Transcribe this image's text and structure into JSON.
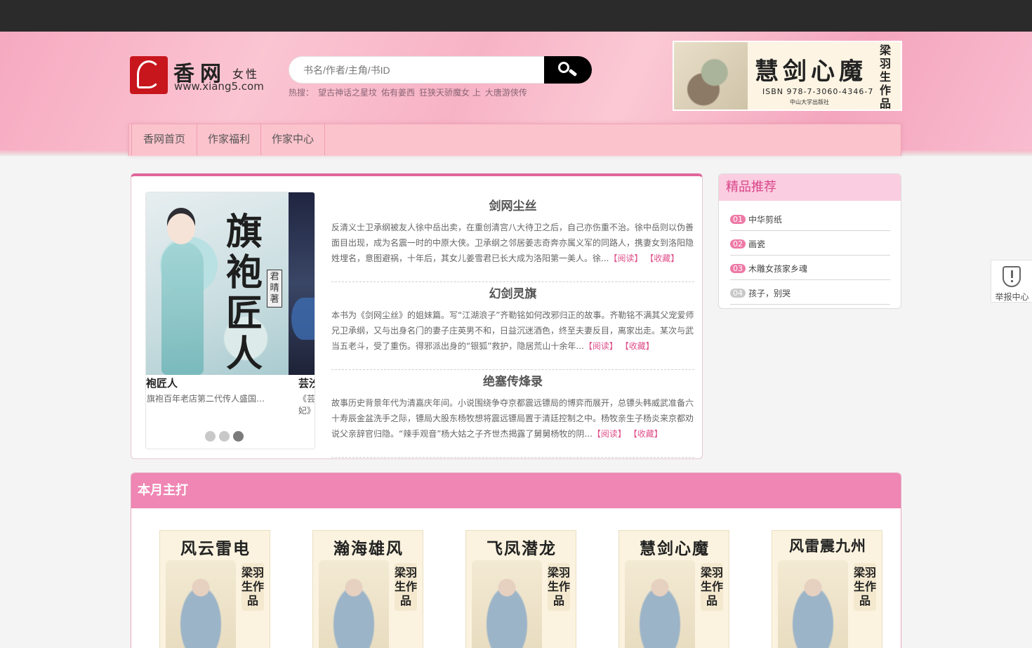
{
  "header": {
    "logo": {
      "title": "香网",
      "subtitle": "女性",
      "url": "www.xiang5.com"
    },
    "search": {
      "placeholder": "书名/作者/主角/书ID"
    },
    "hot": {
      "label": "热搜：",
      "items": [
        "望古神话之星坟",
        "佑有姜西",
        "狂狭天骄魔女 上",
        "大唐游侠传"
      ]
    },
    "banner": {
      "title": "慧剑心魔",
      "isbn": "ISBN 978-7-3060-4346-7",
      "publisher": "中山大学出版社",
      "vertical": "梁羽生作品"
    }
  },
  "nav": {
    "items": [
      "香网首页",
      "作家福利",
      "作家中心"
    ]
  },
  "carousel": {
    "cover_title": "旗袍匠人",
    "cover_author": "君晴著",
    "slides": [
      {
        "title": "袍匠人",
        "desc": "旗袍百年老店第二代传人盛国…"
      },
      {
        "title": "芸汐",
        "desc": "《芸妃》"
      }
    ],
    "active_dot": 3,
    "dot_count": 3
  },
  "featured": [
    {
      "title": "剑网尘丝",
      "desc": "反清义士卫承纲被友人徐中岳出卖，在重创清宫八大待卫之后，自己亦伤重不治。徐中岳则以伪善面目出现，成为名震一时的中原大侠。卫承纲之邻居姜志奇奔亦属义军的同路人，携妻女到洛阳隐姓埋名，意图避祸，十年后，其女儿姜雪君已长大成为洛阳第一美人。徐...",
      "read": "【阅读】",
      "collect": "【收藏】"
    },
    {
      "title": "幻剑灵旗",
      "desc": "本书为《剑网尘丝》的姐妹篇。写“江湖浪子”齐勒铭如何改邪归正的故事。齐勒铭不满其父宠爱师兄卫承纲，又与出身名门的妻子庄英男不和，日益沉迷酒色，终至夫妻反目，离家出走。某次与武当五老斗，受了重伤。得邪派出身的“银狐”救护，隐居荒山十余年...",
      "read": "【阅读】",
      "collect": "【收藏】"
    },
    {
      "title": "绝塞传烽录",
      "desc": "故事历史背景年代为清嘉庆年间。小说围绕争夺京都震远镖局的博弈而展开，总镖头韩威武准备六十寿辰金盆洗手之际，镖局大股东杨牧想将震远镖局置于清廷控制之中。杨牧亲生子杨炎来京都劝说父亲辞官归隐。“辣手观音”杨大姑之子齐世杰揭露了舅舅杨牧的阴...",
      "read": "【阅读】",
      "collect": "【收藏】"
    }
  ],
  "sidebar": {
    "title": "精品推荐",
    "items": [
      {
        "rank": "01",
        "name": "中华剪纸"
      },
      {
        "rank": "02",
        "name": "画瓷"
      },
      {
        "rank": "03",
        "name": "木雕女孩家乡魂"
      },
      {
        "rank": "04",
        "name": "孩子，别哭"
      }
    ]
  },
  "report": {
    "label": "举报中心"
  },
  "month": {
    "title": "本月主打",
    "books": [
      {
        "title": "风云雷电",
        "vertical": "梁羽生作品"
      },
      {
        "title": "瀚海雄风",
        "vertical": "梁羽生作品"
      },
      {
        "title": "飞凤潜龙",
        "vertical": "梁羽生作品"
      },
      {
        "title": "慧剑心魔",
        "vertical": "梁羽生作品"
      },
      {
        "title": "风雷震九州",
        "vertical": "梁羽生作品"
      }
    ]
  },
  "colors": {
    "accent": "#e0659a",
    "nav_bg": "#fbc3cc",
    "month_head": "#ef86b3",
    "topbar": "#2b2b2b"
  }
}
